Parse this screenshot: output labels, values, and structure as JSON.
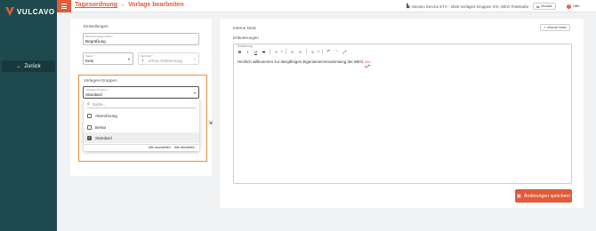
{
  "app": {
    "brand": "VULCAVO",
    "back_label": "Zurück"
  },
  "header": {
    "breadcrumb_link": "Tagesordnung",
    "breadcrumb_current": "Vorlage bearbeiten",
    "org_label": "Vulcano Service ETV - 2026 Vorlagen-Gruppen XVI, WEG Teststraße",
    "modules_label": "Module",
    "help_label": "Hilfe"
  },
  "settings": {
    "heading": "Einstellungen",
    "title_field": {
      "label": "Beschlussgegenstand *",
      "value": "Begrüßung"
    },
    "type_field": {
      "label": "Status *",
      "value": "Kein"
    },
    "majority_field": {
      "label": "Mehrheit *",
      "value": "Ohne Abstimmung"
    },
    "groups": {
      "heading": "Vorlagen-Gruppen",
      "field_label": "Vorlagen-Gruppen",
      "value": "Standard",
      "search_placeholder": "Suche...",
      "options": [
        {
          "label": "Abrechnung",
          "checked": false
        },
        {
          "label": "Beirat",
          "checked": false
        },
        {
          "label": "Standard",
          "checked": true
        }
      ],
      "select_all": "Alle auswählen",
      "deselect_all": "Alle abwählen"
    }
  },
  "notes": {
    "internal_label": "Interne Notiz",
    "add_internal_button": "Interne Notiz",
    "explanation_heading": "Erläuterungen",
    "editor_label": "Erläuterung",
    "toolbar": [
      "B",
      "I",
      "U",
      "S",
      "A",
      "≡",
      "≡",
      "≡",
      "↶",
      "↷",
      "⤢"
    ],
    "text_before": "Herzlich willkommen zur diesjährigen Eigentümerversammlung der WEG ",
    "text_marked": "xxx",
    "text_after": "."
  },
  "actions": {
    "save_label": "Änderungen speichern"
  },
  "colors": {
    "accent": "#e15b3a",
    "sidebar": "#1e4a4f",
    "highlight": "#e8903c"
  }
}
